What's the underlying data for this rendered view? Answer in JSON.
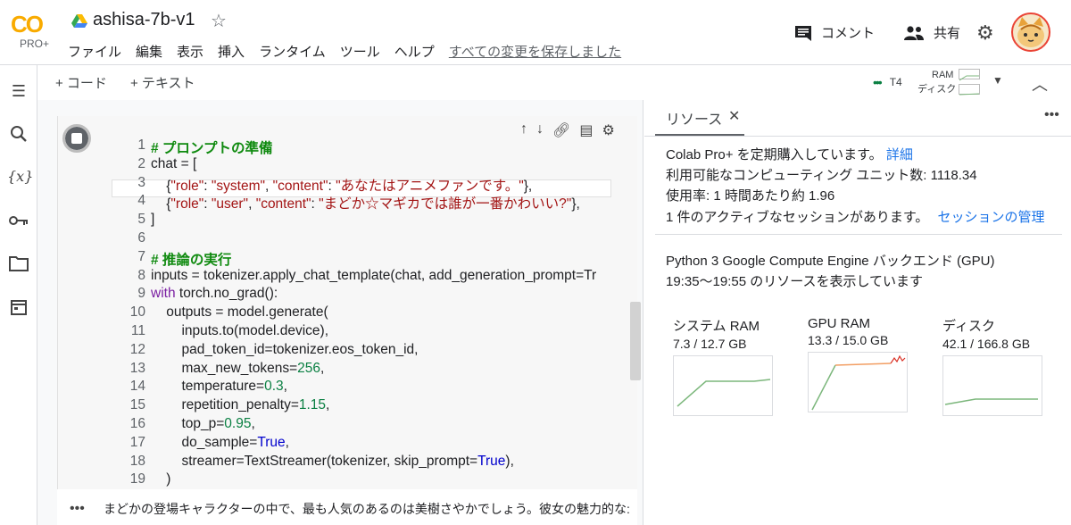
{
  "header": {
    "logo_text": "CO",
    "logo_sub": "PRO+",
    "title": "ashisa-7b-v1",
    "menu": [
      "ファイル",
      "編集",
      "表示",
      "挿入",
      "ランタイム",
      "ツール",
      "ヘルプ"
    ],
    "saved_status": "すべての変更を保存しました",
    "comment_label": "コメント",
    "share_label": "共有"
  },
  "toolbar": {
    "add_code": "+ コード",
    "add_text": "+ テキスト",
    "runtime_label": "T4",
    "ram_label": "RAM",
    "disk_label": "ディスク"
  },
  "cell": {
    "lines": [
      {
        "n": "1",
        "html": "<span class='cm'># プロンプトの準備</span>"
      },
      {
        "n": "2",
        "html": "chat = ["
      },
      {
        "n": "3",
        "html": "    {<span class='st'>\"role\"</span>: <span class='st'>\"system\"</span>, <span class='st'>\"content\"</span>: <span class='st'>\"あなたはアニメファンです。\"</span>},"
      },
      {
        "n": "4",
        "html": "    {<span class='st'>\"role\"</span>: <span class='st'>\"user\"</span>, <span class='st'>\"content\"</span>: <span class='st'>\"まどか☆マギカでは誰が一番かわいい?\"</span>},"
      },
      {
        "n": "5",
        "html": "]"
      },
      {
        "n": "6",
        "html": ""
      },
      {
        "n": "7",
        "html": "<span class='cm'># 推論の実行</span>"
      },
      {
        "n": "8",
        "html": "inputs = tokenizer.apply_chat_template(chat, add_generation_prompt=Tr"
      },
      {
        "n": "9",
        "html": "<span class='kw'>with</span> torch.no_grad():"
      },
      {
        "n": "10",
        "html": "    outputs = model.generate("
      },
      {
        "n": "11",
        "html": "        inputs.to(model.device),"
      },
      {
        "n": "12",
        "html": "        pad_token_id=tokenizer.eos_token_id,"
      },
      {
        "n": "13",
        "html": "        max_new_tokens=<span class='nm'>256</span>,"
      },
      {
        "n": "14",
        "html": "        temperature=<span class='nm'>0.3</span>,"
      },
      {
        "n": "15",
        "html": "        repetition_penalty=<span class='nm'>1.15</span>,"
      },
      {
        "n": "16",
        "html": "        top_p=<span class='nm'>0.95</span>,"
      },
      {
        "n": "17",
        "html": "        do_sample=<span class='bl'>True</span>,"
      },
      {
        "n": "18",
        "html": "        streamer=TextStreamer(tokenizer, skip_prompt=<span class='bl'>True</span>),"
      },
      {
        "n": "19",
        "html": "    )"
      }
    ],
    "output_text": "まどかの登場キャラクターの中で、最も人気のあるのは美樹さやかでしょう。彼女の魅力的な:"
  },
  "panel": {
    "tab_label": "リソース",
    "line1": "Colab Pro+ を定期購入しています。",
    "line1_link": "詳細",
    "line2": "利用可能なコンピューティング ユニット数: 1118.34",
    "line3": "使用率: 1 時間あたり約 1.96",
    "line4": "1 件のアクティブなセッションがあります。",
    "line4_link": "セッションの管理",
    "backend": "Python 3 Google Compute Engine バックエンド (GPU)",
    "period": "19:35〜19:55 のリソースを表示しています",
    "resources": [
      {
        "name": "システム RAM",
        "value": "7.3 / 12.7 GB",
        "usage": 0.57
      },
      {
        "name": "GPU RAM",
        "value": "13.3 / 15.0 GB",
        "usage": 0.89
      },
      {
        "name": "ディスク",
        "value": "42.1 / 166.8 GB",
        "usage": 0.25
      }
    ],
    "colors": {
      "graph_green": "#7cb77c",
      "graph_orange": "#f29e63",
      "graph_red": "#d93025",
      "link": "#1a73e8"
    }
  }
}
